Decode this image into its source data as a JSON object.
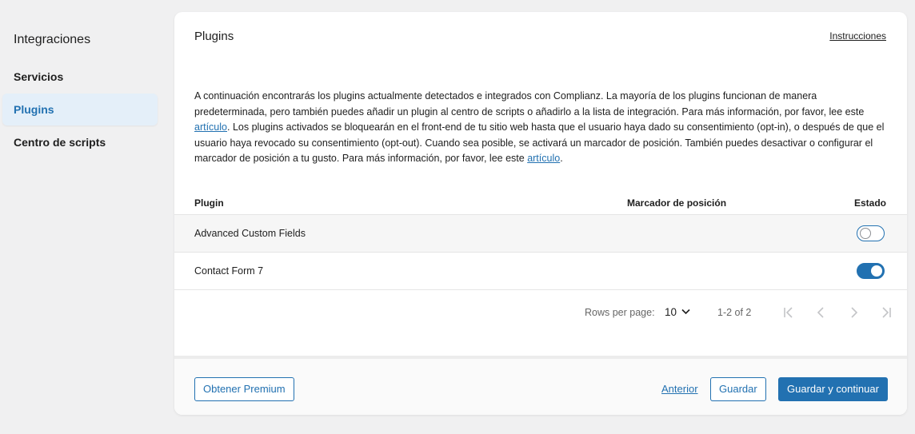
{
  "sidebar": {
    "title": "Integraciones",
    "items": [
      {
        "label": "Servicios",
        "active": false
      },
      {
        "label": "Plugins",
        "active": true
      },
      {
        "label": "Centro de scripts",
        "active": false
      }
    ]
  },
  "card": {
    "title": "Plugins",
    "instructions_link": "Instrucciones",
    "description": {
      "part1": "A continuación encontrarás los plugins actualmente detectados e integrados con Complianz. La mayoría de los plugins funcionan de manera predeterminada, pero también puedes añadir un plugin al centro de scripts o añadirlo a la lista de integración. Para más información, por favor, lee este ",
      "link1": "artículo",
      "part2": ". Los plugins activados se bloquearán en el front-end de tu sitio web hasta que el usuario haya dado su consentimiento (opt-in), o después de que el usuario haya revocado su consentimiento (opt-out). Cuando sea posible, se activará un marcador de posición. También puedes desactivar o configurar el marcador de posición a tu gusto. Para más información, por favor, lee este ",
      "link2": "artículo",
      "part3": "."
    }
  },
  "table": {
    "columns": {
      "plugin": "Plugin",
      "placeholder": "Marcador de posición",
      "status": "Estado"
    },
    "rows": [
      {
        "name": "Advanced Custom Fields",
        "enabled": false
      },
      {
        "name": "Contact Form 7",
        "enabled": true
      }
    ]
  },
  "pagination": {
    "rows_per_page_label": "Rows per page:",
    "rows_per_page_value": "10",
    "range": "1-2 of 2"
  },
  "footer": {
    "premium": "Obtener Premium",
    "previous": "Anterior",
    "save": "Guardar",
    "save_continue": "Guardar y continuar"
  },
  "colors": {
    "accent": "#2271b1",
    "background": "#f0f0f1"
  }
}
